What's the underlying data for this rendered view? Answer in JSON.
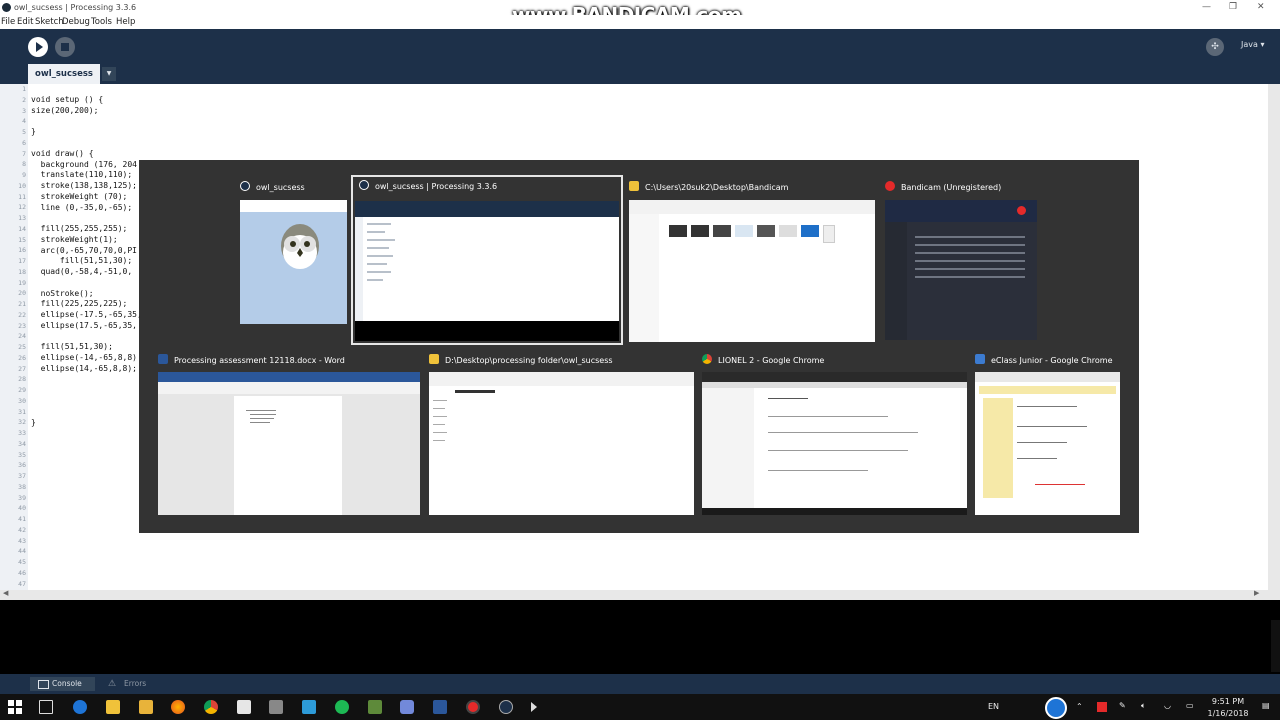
{
  "window": {
    "title": "owl_sucsess | Processing 3.3.6",
    "watermark": "www.BANDICAM.com",
    "controls": [
      "—",
      "❐",
      "✕"
    ]
  },
  "menu": [
    "File",
    "Edit",
    "Sketch",
    "Debug",
    "Tools",
    "Help"
  ],
  "toolbar": {
    "mode_label": "Java ▾",
    "mode_icon": "butterfly-icon"
  },
  "tab": {
    "name": "owl_sucsess",
    "arrow": "▼"
  },
  "editor": {
    "line_numbers": [
      "1",
      "2",
      "3",
      "4",
      "5",
      "6",
      "7",
      "8",
      "9",
      "10",
      "11",
      "12",
      "13",
      "14",
      "15",
      "16",
      "17",
      "18",
      "19",
      "20",
      "21",
      "22",
      "23",
      "24",
      "25",
      "26",
      "27",
      "28",
      "29",
      "30",
      "31",
      "32",
      "33",
      "34",
      "35",
      "36",
      "37",
      "38",
      "39",
      "40",
      "41",
      "42",
      "43",
      "44",
      "45",
      "46",
      "47"
    ],
    "lines": [
      "void setup () {",
      "size(200,200);",
      "",
      "}",
      "",
      "void draw() {",
      "  background (176, 204",
      "  translate(110,110);",
      "  stroke(138,138,125);",
      "  strokeWeight (70);",
      "  line (0,-35,0,-65);",
      "",
      "  fill(255,255,255);",
      "  strokeWeight(1);",
      "  arc(0,-65,70,70,0,PI",
      "      fill(51,51,30);",
      "  quad(0,-58,4,-51,0,",
      "",
      "  noStroke();",
      "  fill(225,225,225);",
      "  ellipse(-17.5,-65,35,",
      "  ellipse(17.5,-65,35,",
      "",
      "  fill(51,51,30);",
      "  ellipse(-14,-65,8,8)",
      "  ellipse(14,-65,8,8);",
      "",
      "",
      "",
      "",
      "}"
    ]
  },
  "console": {
    "console_label": "Console",
    "errors_label": "Errors"
  },
  "switcher": {
    "row1": [
      {
        "title": "owl_sucsess",
        "icon": "processing-icon"
      },
      {
        "title": "owl_sucsess | Processing 3.3.6",
        "icon": "processing-icon",
        "selected": true
      },
      {
        "title": "C:\\Users\\20suk2\\Desktop\\Bandicam",
        "icon": "folder-icon"
      },
      {
        "title": "Bandicam (Unregistered)",
        "icon": "record-icon"
      }
    ],
    "row2": [
      {
        "title": "Processing assessment 12118.docx - Word",
        "icon": "word-icon"
      },
      {
        "title": "D:\\Desktop\\processing folder\\owl_sucsess",
        "icon": "folder-icon"
      },
      {
        "title": "LIONEL 2 - Google Chrome",
        "icon": "chrome-icon"
      },
      {
        "title": "eClass Junior - Google Chrome",
        "icon": "eclass-icon"
      }
    ]
  },
  "taskbar": {
    "language": "EN",
    "time": "9:51 PM",
    "date": "1/16/2018",
    "colors": {
      "accent": "#1d3049",
      "taskbar": "#111111"
    }
  }
}
